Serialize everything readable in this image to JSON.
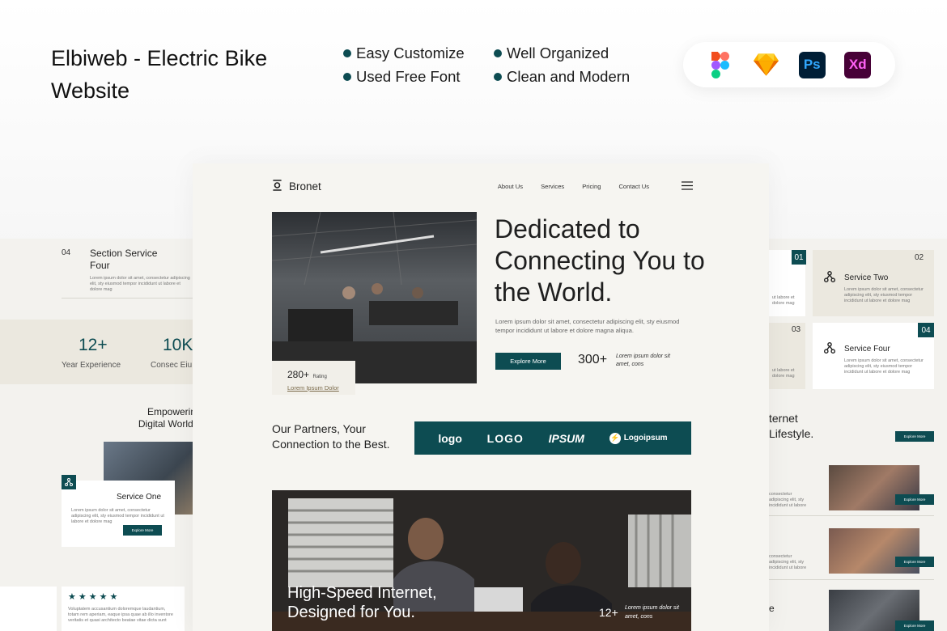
{
  "header": {
    "title": "Elbiweb - Electric Bike Website",
    "features": [
      "Easy Customize",
      "Well Organized",
      "Used Free Font",
      "Clean and Modern"
    ],
    "tools": [
      {
        "name": "figma-icon",
        "color": "#f24e1e"
      },
      {
        "name": "sketch-icon",
        "label": "",
        "color": "#f7b500"
      },
      {
        "name": "photoshop-icon",
        "label": "Ps",
        "color": "#001e36",
        "text": "#31a8ff"
      },
      {
        "name": "xd-icon",
        "label": "Xd",
        "color": "#470137",
        "text": "#ff61f6"
      }
    ]
  },
  "site": {
    "brand": "Bronet",
    "nav": [
      "About Us",
      "Services",
      "Pricing",
      "Contact Us"
    ],
    "hero_title": "Dedicated to Connecting You to the World.",
    "hero_text": "Lorem ipsum dolor sit amet, consectetur adipiscing elit, sty eiusmod tempor incididunt ut labore et dolore magna aliqua.",
    "cta": "Explore More",
    "stat_value": "300+",
    "stat_text": "Lorem ipsum dolor sit amet, cons",
    "rating_value": "280+",
    "rating_label": "Rating",
    "rating_link": "Lorem Ipsum Dolor",
    "partners_title": "Our Partners, Your Connection to the Best.",
    "partner_logos": [
      "logo",
      "LOGO",
      "IPSUM",
      "Logoipsum"
    ],
    "banner_title": "High-Speed Internet, Designed for You.",
    "banner_stat": "12+",
    "banner_stat_text": "Lorem ipsum dolor sit amet, cons"
  },
  "left_panel": {
    "section_num": "04",
    "section_title": "Section Service Four",
    "section_text": "Lorem ipsum dolor sit amet, consectetur adipiscing elit, sty eiusmod tempor incididunt ut labore et dolore mag",
    "stat1_value": "12+",
    "stat1_label": "Year Experience",
    "stat2_value": "10K",
    "stat2_label": "Consec Eiu",
    "heading": "Empowerin Digital World,",
    "service_title": "Service One",
    "service_text": "Lorem ipsum dolor sit amet, consectetur adipiscing elit, sty eiusmod tempor incididunt ut labore et dolore mag",
    "service_cta": "Explore More",
    "stars": "★★★★★",
    "review_text": "Voluptatem accusantium doloremque laudantium, totam rem aperiam, eaque ipsa quae ab illo inventore veritatis et quasi architecto beatae vitae dicta sunt"
  },
  "right_panel": {
    "tags": [
      "01",
      "02",
      "03",
      "04"
    ],
    "service_two": "Service Two",
    "service_four": "Service Four",
    "service_text": "Lorem ipsum dolor sit amet, consectetur adipiscing elit, sty eiusmod tempor incididunt ut labore et dolore mag",
    "side_text": "ut labore et dolore mag",
    "heading": "ternet Lifestyle.",
    "cta": "Explore More",
    "list_text": "consectetur adipiscing elit, sty incididunt ut labore",
    "tail_letter": "e"
  }
}
